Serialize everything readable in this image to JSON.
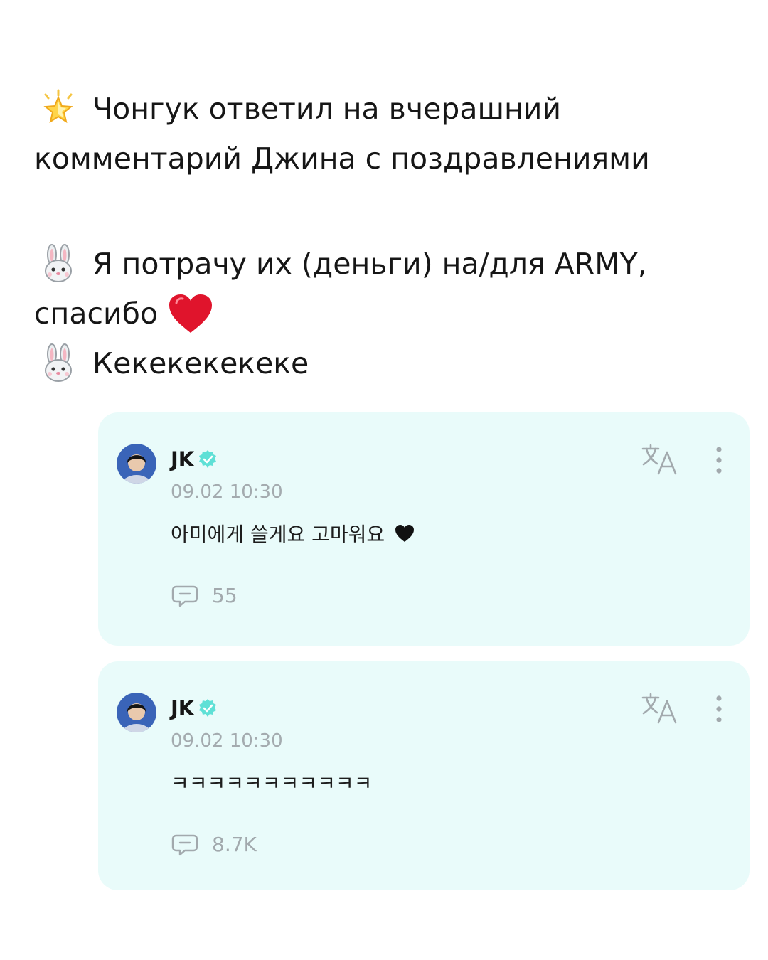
{
  "post": {
    "line1": "Чонгук ответил на вчерашний",
    "line2": "комментарий Джина с поздравлениями",
    "line3": "Я потрачу их (деньги) на/для ARMY,",
    "line4": "спасибо",
    "line5": "Кекекекекеке",
    "icons": [
      "glowing-star-icon",
      "rabbit-face-icon",
      "red-heart-icon"
    ]
  },
  "comments": [
    {
      "author": "JK",
      "timestamp": "09.02 10:30",
      "text": "아미에게 쓸게요 고마워요",
      "reply_count": "55"
    },
    {
      "author": "JK",
      "timestamp": "09.02 10:30",
      "text": "ㅋㅋㅋㅋㅋㅋㅋㅋㅋㅋㅋ",
      "reply_count": "8.7K"
    }
  ],
  "colors": {
    "card_background": "#e9fbfa",
    "verified_badge": "#5fe0d6",
    "muted_text": "#a4abaf",
    "heart_red": "#e0142c"
  }
}
